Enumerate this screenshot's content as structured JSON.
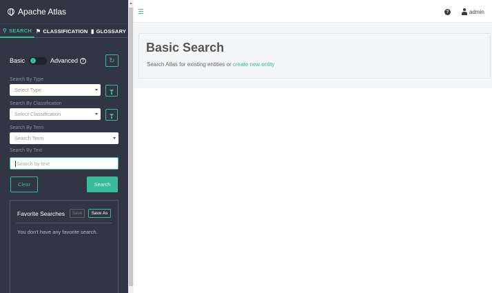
{
  "sidebar": {
    "brand": "Apache Atlas",
    "tabs": [
      {
        "label": "SEARCH",
        "icon": "search-icon",
        "active": true
      },
      {
        "label": "CLASSIFICATION",
        "icon": "tag-icon",
        "active": false
      },
      {
        "label": "GLOSSARY",
        "icon": "folder-icon",
        "active": false
      }
    ],
    "mode": {
      "basic_label": "Basic",
      "advanced_label": "Advanced",
      "toggle_state": "basic"
    },
    "filters": {
      "type": {
        "label": "Search By Type",
        "placeholder": "Select Type"
      },
      "classification": {
        "label": "Search By Classification",
        "placeholder": "Select Classification"
      },
      "term": {
        "label": "Search By Term",
        "placeholder": "Search Term"
      },
      "text": {
        "label": "Search By Text",
        "placeholder": "Search by text"
      }
    },
    "buttons": {
      "clear": "Clear",
      "search": "Search"
    },
    "favorites": {
      "title": "Favorite Searches",
      "save": "Save",
      "save_as": "Save As",
      "empty": "You don't have any favorite search."
    }
  },
  "topbar": {
    "user": "admin"
  },
  "main": {
    "title": "Basic Search",
    "subtitle": "Search Atlas for existing entities or ",
    "link": "create new entity"
  },
  "colors": {
    "accent": "#37bb9b",
    "sidebar": "#323544"
  }
}
